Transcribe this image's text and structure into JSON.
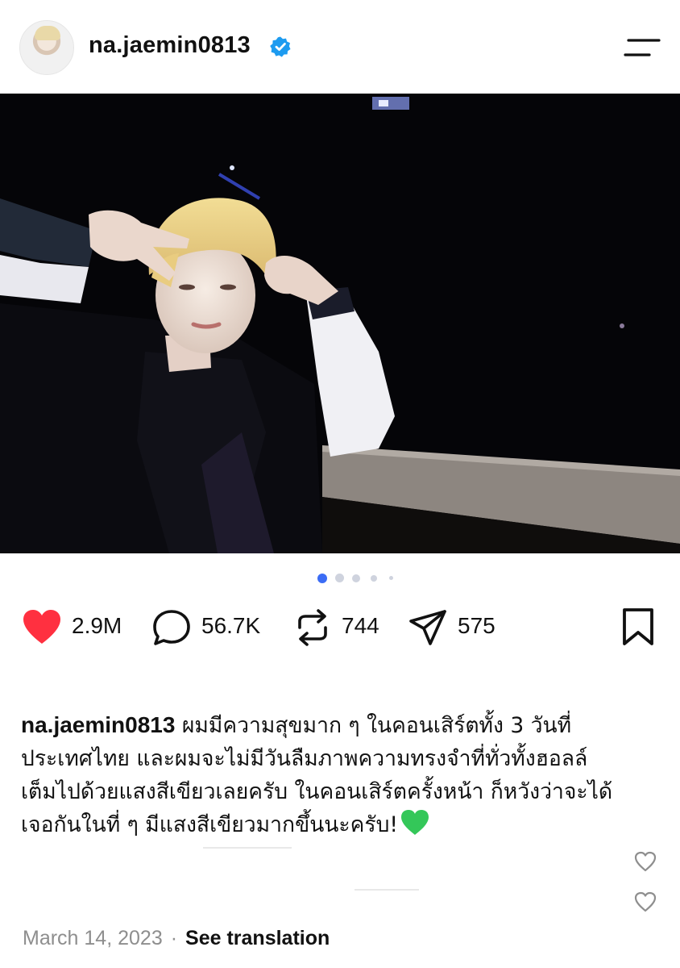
{
  "header": {
    "username": "na.jaemin0813",
    "verified_icon": "verified-badge-icon",
    "menu_icon": "menu-icon",
    "accent_color": "#0095f6"
  },
  "carousel": {
    "slide_count": 5,
    "active_index": 0,
    "active_color": "#3b6cf5"
  },
  "actions": {
    "like_count": "2.9M",
    "comment_count": "56.7K",
    "repost_count": "744",
    "share_count": "575",
    "like_color": "#ff3040"
  },
  "caption": {
    "username": "na.jaemin0813",
    "lines": [
      "ผมมีความสุขมาก ๆ ในคอนเสิร์ตทั้ง 3 วันที่",
      "ประเทศไทย และผมจะไม่มีวันลืมภาพความทรงจำที่ทั่วทั้งฮอลล์",
      "เต็มไปด้วยแสงสีเขียวเลยครับ ในคอนเสิร์ตครั้งหน้า ก็หวังว่าจะได้",
      "เจอกันในที่ ๆ มีแสงสีเขียวมากขึ้นนะครับ!"
    ],
    "emoji": "green-heart-icon"
  },
  "footer": {
    "date": "March 14, 2023",
    "separator": "·",
    "translate_label": "See translation"
  }
}
